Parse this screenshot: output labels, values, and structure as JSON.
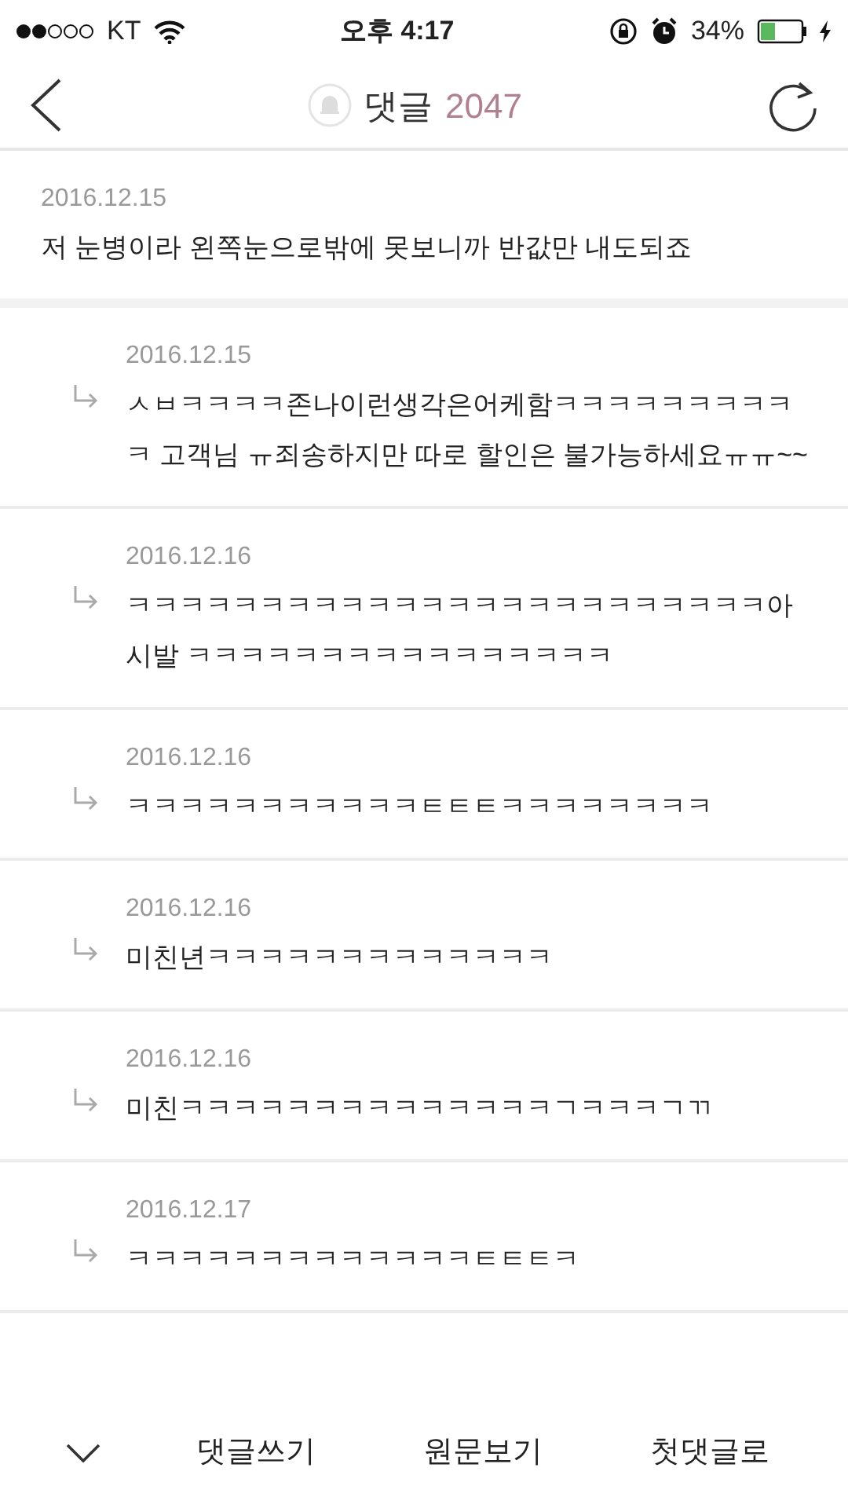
{
  "status_bar": {
    "carrier": "KT",
    "time": "오후 4:17",
    "battery": "34%"
  },
  "header": {
    "title": "댓글",
    "count": "2047"
  },
  "comment": {
    "date": "2016.12.15",
    "text": "저 눈병이라 왼쪽눈으로밖에 못보니까 반값만 내도되죠"
  },
  "replies": [
    {
      "date": "2016.12.15",
      "text": "ㅅㅂㅋㅋㅋㅋ존나이런생각은어케함ㅋㅋㅋㅋㅋㅋㅋㅋㅋㅋ 고객님 ㅠ죄송하지만 따로 할인은 불가능하세요ㅠㅠ~~"
    },
    {
      "date": "2016.12.16",
      "text": "ㅋㅋㅋㅋㅋㅋㅋㅋㅋㅋㅋㅋㅋㅋㅋㅋㅋㅋㅋㅋㅋㅋㅋㅋ아시발 ㅋㅋㅋㅋㅋㅋㅋㅋㅋㅋㅋㅋㅋㅋㅋㅋ"
    },
    {
      "date": "2016.12.16",
      "text": "ㅋㅋㅋㅋㅋㅋㅋㅋㅋㅋㅋㅌㅌㅌㅋㅋㅋㅋㅋㅋㅋㅋ"
    },
    {
      "date": "2016.12.16",
      "text": "미친년ㅋㅋㅋㅋㅋㅋㅋㅋㅋㅋㅋㅋㅋ"
    },
    {
      "date": "2016.12.16",
      "text": "미친ㅋㅋㅋㅋㅋㅋㅋㅋㅋㅋㅋㅋㅋㅋㄱㅋㅋㅋㄱㄲ"
    },
    {
      "date": "2016.12.17",
      "text": "ㅋㅋㅋㅋㅋㅋㅋㅋㅋㅋㅋㅋㅋㅌㅌㅌㅋ"
    }
  ],
  "bottom_bar": {
    "buttons": [
      "댓글쓰기",
      "원문보기",
      "첫댓글로"
    ]
  }
}
